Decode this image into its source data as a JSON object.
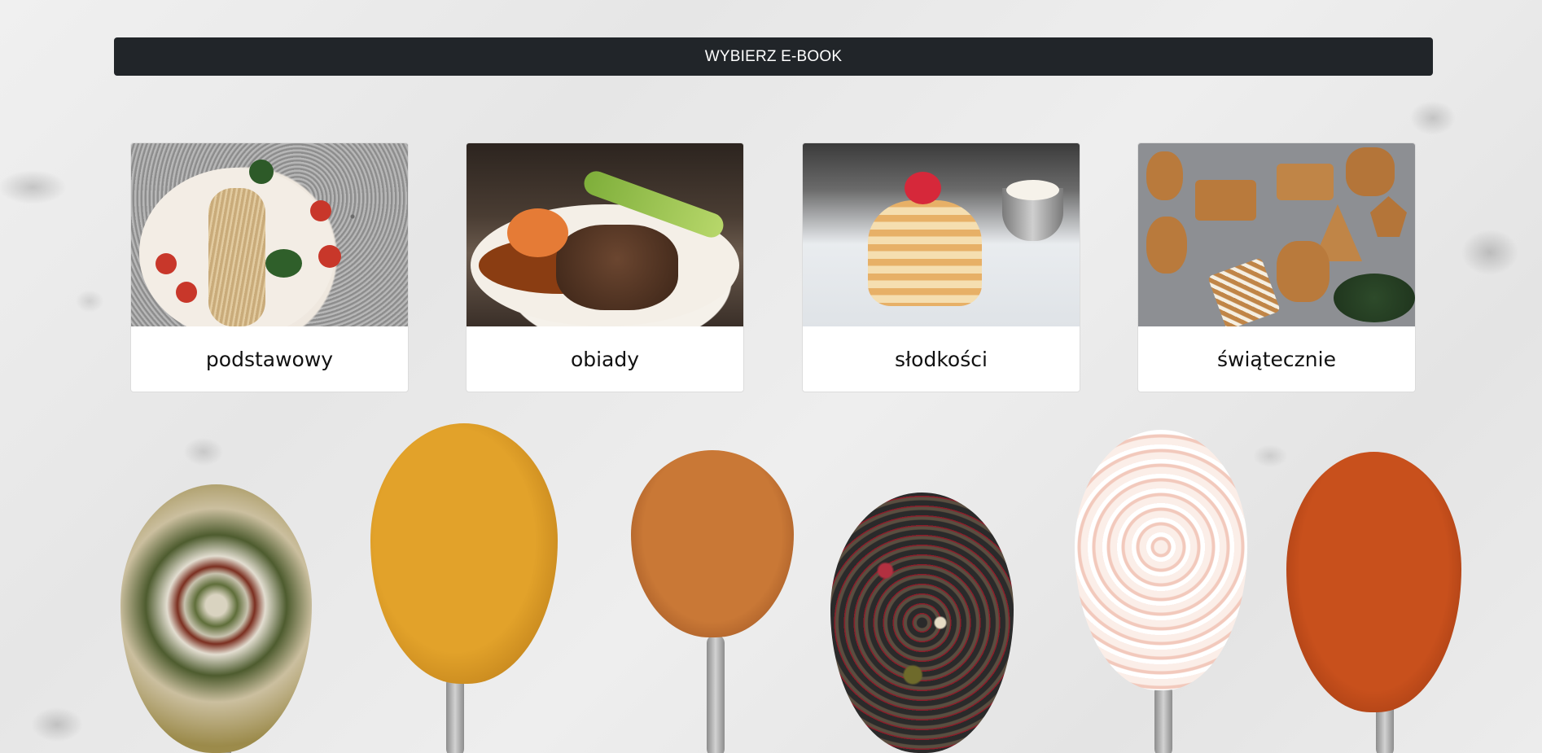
{
  "header": {
    "title": "WYBIERZ E-BOOK"
  },
  "categories": [
    {
      "label": "podstawowy",
      "image": "pasta-photo"
    },
    {
      "label": "obiady",
      "image": "steak-dinner-photo"
    },
    {
      "label": "słodkości",
      "image": "pancakes-photo"
    },
    {
      "label": "świątecznie",
      "image": "gingerbread-cookies-photo"
    }
  ],
  "background": {
    "image": "spice-spoons-on-marble-photo"
  },
  "colors": {
    "header_bg": "#212529",
    "header_text": "#ffffff",
    "card_bg": "#ffffff"
  }
}
